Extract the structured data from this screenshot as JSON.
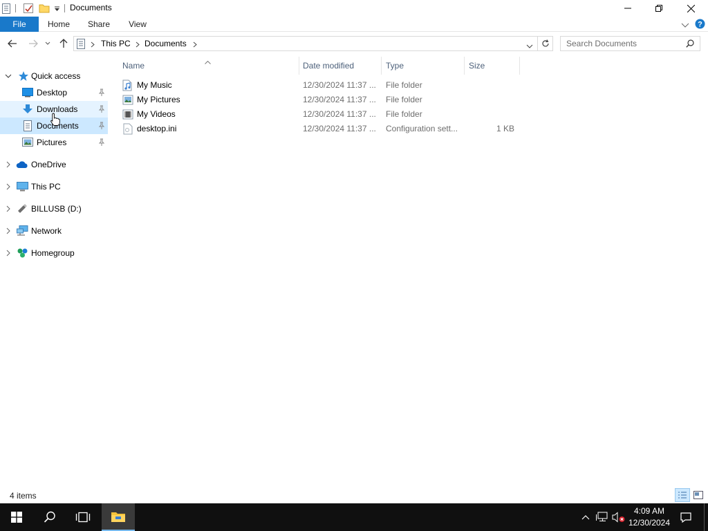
{
  "window": {
    "title": "Documents"
  },
  "ribbon": {
    "tabs": [
      "File",
      "Home",
      "Share",
      "View"
    ]
  },
  "address": {
    "segments": [
      "This PC",
      "Documents"
    ]
  },
  "search": {
    "placeholder": "Search Documents"
  },
  "nav": {
    "quick_access": "Quick access",
    "quick_items": [
      {
        "label": "Desktop",
        "icon": "desktop-icon",
        "pinned": true
      },
      {
        "label": "Downloads",
        "icon": "downloads-icon",
        "pinned": true
      },
      {
        "label": "Documents",
        "icon": "documents-icon",
        "pinned": true,
        "selected": true
      },
      {
        "label": "Pictures",
        "icon": "pictures-icon",
        "pinned": true
      }
    ],
    "roots": [
      {
        "label": "OneDrive",
        "icon": "onedrive-icon"
      },
      {
        "label": "This PC",
        "icon": "this-pc-icon"
      },
      {
        "label": "BILLUSB (D:)",
        "icon": "usb-drive-icon"
      },
      {
        "label": "Network",
        "icon": "network-icon"
      },
      {
        "label": "Homegroup",
        "icon": "homegroup-icon"
      }
    ]
  },
  "columns": {
    "name": "Name",
    "date": "Date modified",
    "type": "Type",
    "size": "Size"
  },
  "files": [
    {
      "name": "My Music",
      "date": "12/30/2024 11:37 ...",
      "type": "File folder",
      "size": "",
      "icon": "music-folder-icon"
    },
    {
      "name": "My Pictures",
      "date": "12/30/2024 11:37 ...",
      "type": "File folder",
      "size": "",
      "icon": "pictures-folder-icon"
    },
    {
      "name": "My Videos",
      "date": "12/30/2024 11:37 ...",
      "type": "File folder",
      "size": "",
      "icon": "videos-folder-icon"
    },
    {
      "name": "desktop.ini",
      "date": "12/30/2024 11:37 ...",
      "type": "Configuration sett...",
      "size": "1 KB",
      "icon": "config-file-icon"
    }
  ],
  "status": {
    "item_count": "4 items"
  },
  "taskbar": {
    "time": "4:09 AM",
    "date": "12/30/2024"
  },
  "colors": {
    "accent": "#1979ca",
    "selection": "#cce8ff",
    "hover": "#e5f3ff",
    "taskbar": "#101010"
  }
}
